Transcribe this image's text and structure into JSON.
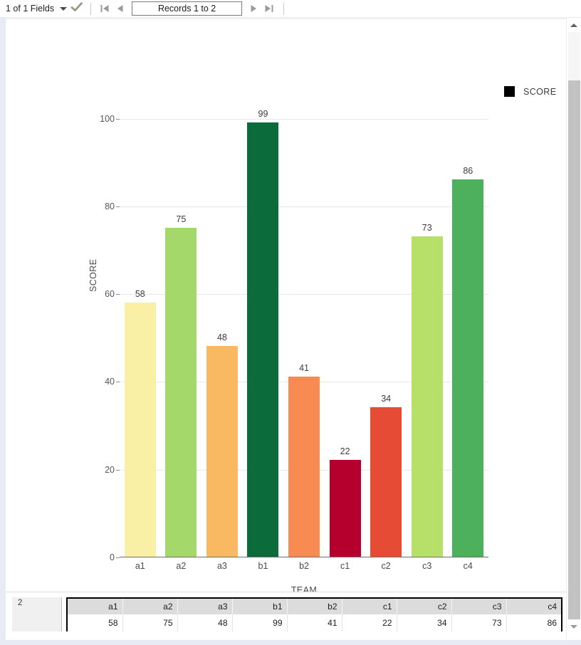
{
  "toolbar": {
    "fields_label": "1 of 1 Fields",
    "caret_icon": "chevron-down-icon",
    "check_icon": "checkmark-icon",
    "first_icon": "first-record-icon",
    "prev_icon": "previous-record-icon",
    "records_label": "Records 1 to 2",
    "next_icon": "next-record-icon",
    "last_icon": "last-record-icon"
  },
  "legend": {
    "label": "SCORE",
    "swatch_color": "#000000"
  },
  "grid": {
    "row_label": "2",
    "headers": [
      "a1",
      "a2",
      "a3",
      "b1",
      "b2",
      "c1",
      "c2",
      "c3",
      "c4"
    ],
    "values": [
      "58",
      "75",
      "48",
      "99",
      "41",
      "22",
      "34",
      "73",
      "86"
    ]
  },
  "scrollbar": {
    "up_icon": "scroll-up-icon",
    "down_icon": "scroll-down-icon"
  },
  "chart_data": {
    "type": "bar",
    "title": "",
    "categories": [
      "a1",
      "a2",
      "a3",
      "b1",
      "b2",
      "c1",
      "c2",
      "c3",
      "c4"
    ],
    "values": [
      58,
      75,
      48,
      99,
      41,
      22,
      34,
      73,
      86
    ],
    "colors": [
      "#FAF0A5",
      "#A5D86A",
      "#F9B963",
      "#0B6B3A",
      "#F78B51",
      "#B5002E",
      "#E64B35",
      "#B7E068",
      "#4CB05C"
    ],
    "xlabel": "TEAM",
    "ylabel": "SCORE",
    "ylim": [
      0,
      104
    ],
    "yticks": [
      0,
      20,
      40,
      60,
      80,
      100
    ],
    "ytick_labels": [
      "0",
      "20",
      "40",
      "60",
      "80",
      "100"
    ],
    "grid": true,
    "legend": [
      "SCORE"
    ],
    "legend_position": "top-right",
    "show_value_labels": true
  }
}
